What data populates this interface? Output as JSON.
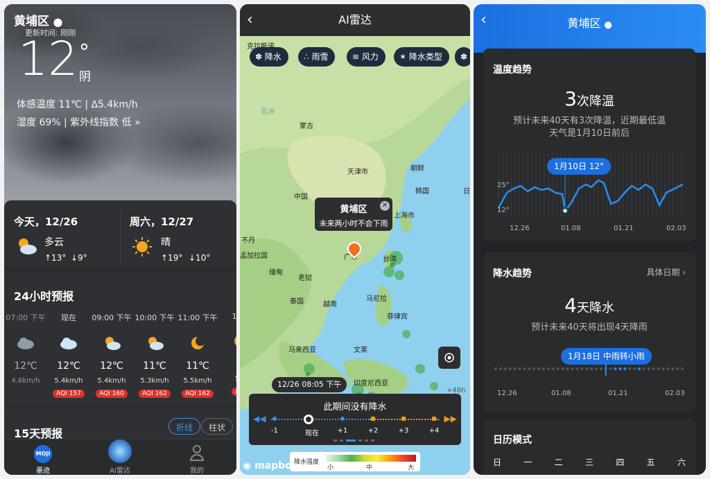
{
  "weather": {
    "city": "黄埔区",
    "updated": "更新时间: 刚刚",
    "temp": "12",
    "degree": "°",
    "condition": "阴",
    "feels": "体感温度 11℃ | ∆5.4km/h",
    "humidity": "湿度 69% | 紫外线指数 低 »",
    "today": {
      "label": "今天，12/26",
      "cond": "多云",
      "high": "↑13°",
      "low": "↓9°"
    },
    "tomorrow": {
      "label": "周六，12/27",
      "cond": "晴",
      "high": "↑19°",
      "low": "↓10°"
    },
    "hourly_title": "24小时预报",
    "hourly": [
      {
        "time": "07:00 下午",
        "icon": "cloud-icon",
        "temp": "12℃",
        "wind": "4.6km/h",
        "aqi": ""
      },
      {
        "time": "现在",
        "icon": "cloud-icon",
        "temp": "12℃",
        "wind": "5.4km/h",
        "aqi": "AQI 157"
      },
      {
        "time": "09:00 下午",
        "icon": "partly-cloudy-icon",
        "temp": "12℃",
        "wind": "5.4km/h",
        "aqi": "AQI 160"
      },
      {
        "time": "10:00 下午",
        "icon": "partly-cloudy-icon",
        "temp": "11℃",
        "wind": "5.3km/h",
        "aqi": "AQI 162"
      },
      {
        "time": "11:00 下午",
        "icon": "moon-icon",
        "temp": "11℃",
        "wind": "5.5km/h",
        "aqi": "AQI 162"
      },
      {
        "time": "12:0",
        "icon": "moon-icon",
        "temp": "1",
        "wind": "5.8",
        "aqi": "AQI"
      }
    ],
    "fifteen_title": "15天预报",
    "toggle_line": "折线",
    "toggle_bar": "柱状",
    "nav": [
      "墨迹",
      "AI雷达",
      "我的"
    ],
    "nav_logo": "MOJI"
  },
  "radar": {
    "title": "AI雷达",
    "chips": [
      "降水",
      "雨雪",
      "风力",
      "降水类型"
    ],
    "labels": {
      "kl": "克拉斯诺",
      "ya": "亚尔斯克",
      "ya2": "亚洲",
      "mg": "蒙古",
      "tj": "天津市",
      "cx": "朝鲜",
      "hg": "韩国",
      "ri": "日",
      "zg": "中国",
      "sh": "上海市",
      "bu": "不丹",
      "ml": "孟加拉国",
      "md": "缅甸",
      "lw": "老挝",
      "tg": "泰国",
      "yn": "越南",
      "tw": "台湾",
      "gz": "广东",
      "mnl": "马尼拉",
      "flb": "菲律宾",
      "mlx": "马来西亚",
      "wl": "文莱",
      "ydn": "印度尼西亚",
      "n48": "+48h"
    },
    "popup": {
      "title": "黄埔区",
      "text": "未来两小时不会下雨"
    },
    "time_badge": "12/26 08:05 下午",
    "no_precip": "此期间没有降水",
    "ticks": [
      "-1",
      "现在",
      "+1",
      "+2",
      "+3",
      "+4"
    ],
    "legend": {
      "title": "降水强度",
      "low": "小",
      "mid": "中",
      "high": "大"
    },
    "brand": "mapbox"
  },
  "trend": {
    "city": "黄埔区",
    "temp_title": "温度趋势",
    "temp_num": "3",
    "temp_unit": "次降温",
    "temp_desc1": "预计未来40天有3次降温，近期最低温",
    "temp_desc2": "天气是1月10日前后",
    "temp_tooltip": "1月10日 12°",
    "y_labels": [
      "25°",
      "12°"
    ],
    "x_labels": [
      "12.26",
      "01.08",
      "01.21",
      "02.03"
    ],
    "rain_title": "降水趋势",
    "rain_link": "具体日期 ›",
    "rain_num": "4",
    "rain_unit": "天降水",
    "rain_desc": "预计未来40天将出现4天降雨",
    "rain_tooltip": "1月18日 中雨转小雨",
    "cal_title": "日历模式",
    "weekdays": [
      "日",
      "一",
      "二",
      "三",
      "四",
      "五",
      "六"
    ]
  }
}
